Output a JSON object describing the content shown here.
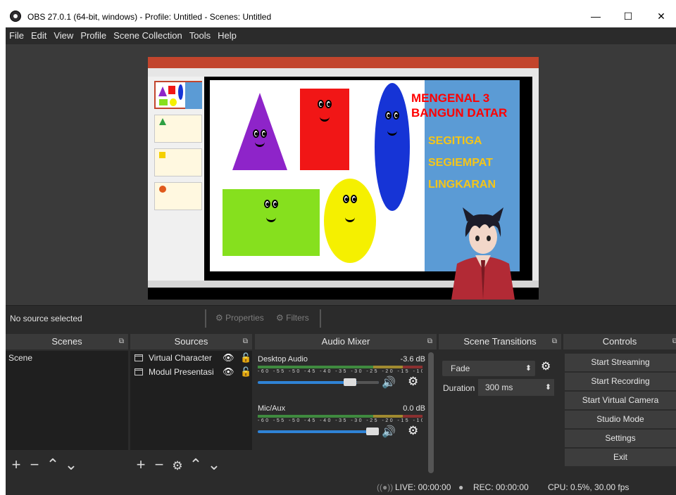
{
  "window": {
    "title": "OBS 27.0.1 (64-bit, windows) - Profile: Untitled - Scenes: Untitled",
    "minimize": "—",
    "maximize": "☐",
    "close": "✕"
  },
  "menu": [
    "File",
    "Edit",
    "View",
    "Profile",
    "Scene Collection",
    "Tools",
    "Help"
  ],
  "slide": {
    "title_line1": "MENGENAL 3",
    "title_line2": "BANGUN DATAR",
    "item1": "SEGITIGA",
    "item2": "SEGIEMPAT",
    "item3": "LINGKARAN",
    "colors": {
      "triangle": "#8e24c9",
      "square": "#f11616",
      "oval": "#1634d6",
      "rect": "#86e01e",
      "circle": "#f5f000",
      "title": "#ff0000",
      "items": "#f5c518"
    }
  },
  "source_bar": {
    "no_source": "No source selected",
    "properties": "Properties",
    "filters": "Filters"
  },
  "docks": {
    "scenes": {
      "title": "Scenes",
      "items": [
        "Scene"
      ]
    },
    "sources": {
      "title": "Sources",
      "items": [
        "Virtual Character",
        "Modul Presentasi"
      ]
    },
    "mixer": {
      "title": "Audio Mixer",
      "channels": [
        {
          "name": "Desktop Audio",
          "db": "-3.6 dB",
          "level": 0.79
        },
        {
          "name": "Mic/Aux",
          "db": "0.0 dB",
          "level": 1.0
        }
      ],
      "ticks": "-60 -55 -50 -45 -40 -35 -30 -25 -20 -15 -10 -5 0"
    },
    "transitions": {
      "title": "Scene Transitions",
      "selected": "Fade",
      "duration_label": "Duration",
      "duration_value": "300 ms"
    },
    "controls": {
      "title": "Controls",
      "buttons": [
        "Start Streaming",
        "Start Recording",
        "Start Virtual Camera",
        "Studio Mode",
        "Settings",
        "Exit"
      ]
    }
  },
  "status": {
    "live": "LIVE: 00:00:00",
    "rec": "REC: 00:00:00",
    "cpu": "CPU: 0.5%, 30.00 fps"
  }
}
